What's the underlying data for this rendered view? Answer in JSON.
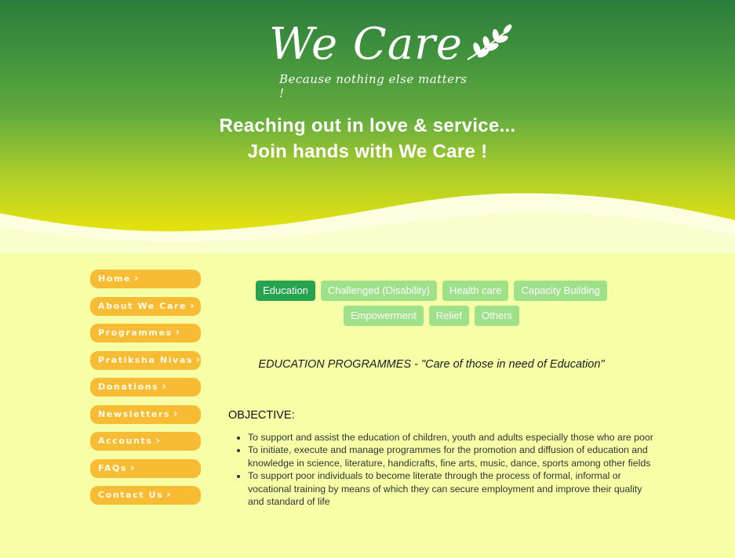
{
  "brand": {
    "logo_text": "We Care",
    "tagline": "Because nothing else matters !"
  },
  "hero": {
    "line1": "Reaching out in love & service...",
    "line2": "Join hands with We Care !"
  },
  "sidebar": {
    "items": [
      {
        "label": "Home"
      },
      {
        "label": "About We Care"
      },
      {
        "label": "Programmes"
      },
      {
        "label": "Pratiksha Nivas"
      },
      {
        "label": "Donations"
      },
      {
        "label": "Newsletters"
      },
      {
        "label": "Accounts"
      },
      {
        "label": "FAQs"
      },
      {
        "label": "Contact Us"
      }
    ]
  },
  "tabs": [
    {
      "label": "Education",
      "active": true
    },
    {
      "label": "Challenged (Disability)",
      "active": false
    },
    {
      "label": "Health care",
      "active": false
    },
    {
      "label": "Capacity Building",
      "active": false
    },
    {
      "label": "Empowerment",
      "active": false
    },
    {
      "label": "Relief",
      "active": false
    },
    {
      "label": "Others",
      "active": false
    }
  ],
  "content": {
    "heading": "EDUCATION PROGRAMMES - \"Care of those in need of Education\"",
    "objective_label": "OBJECTIVE:",
    "objectives": [
      "To support and assist the education of children, youth and adults especially those who are poor",
      "To initiate, execute and manage programmes for the promotion and diffusion of education and knowledge in science, literature, handicrafts, fine arts, music, dance, sports among other fields",
      "To support poor individuals to become literate through the process of formal, informal or vocational training by means of which they can secure employment and improve their quality and standard of life"
    ]
  },
  "colors": {
    "page_bg": "#f6fea6",
    "nav_bg": "#f7bb34",
    "tab_active": "#27a24e",
    "tab_inactive": "#9fe08a"
  }
}
